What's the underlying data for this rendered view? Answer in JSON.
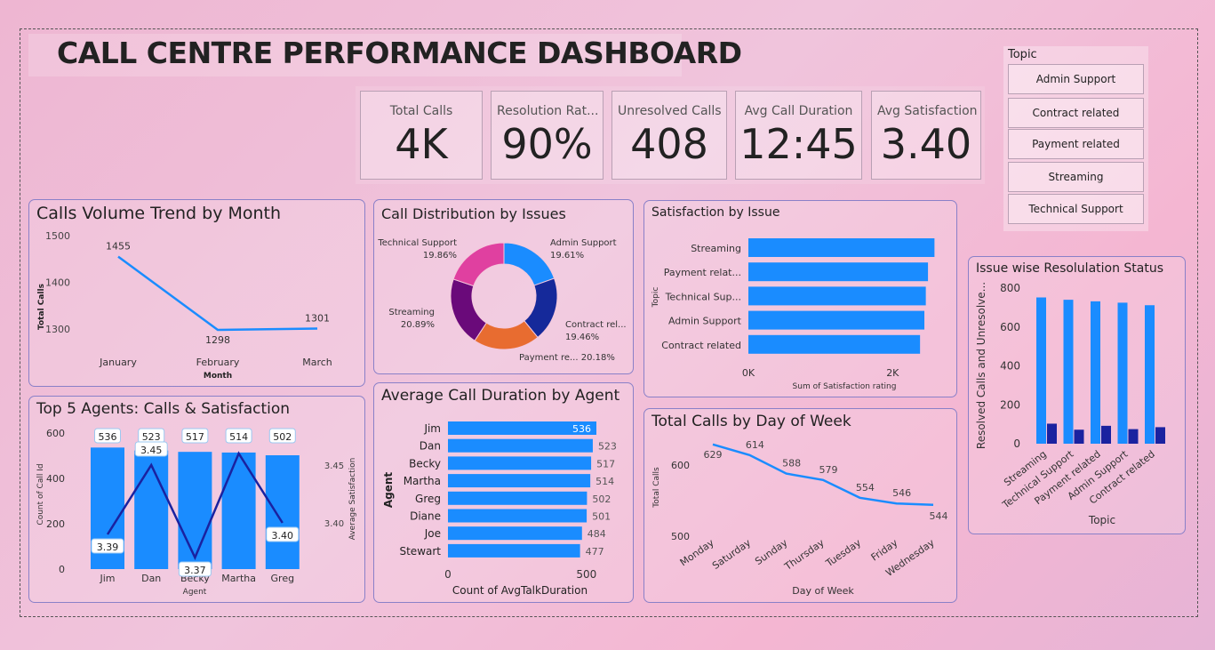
{
  "title": "CALL CENTRE PERFORMANCE DASHBOARD",
  "kpis": [
    {
      "label": "Total Calls",
      "value": "4K"
    },
    {
      "label": "Resolution Rat...",
      "value": "90%"
    },
    {
      "label": "Unresolved Calls",
      "value": "408"
    },
    {
      "label": "Avg Call Duration",
      "value": "12:45"
    },
    {
      "label": "Avg Satisfaction",
      "value": "3.40"
    }
  ],
  "slicer": {
    "header": "Topic",
    "items": [
      "Admin Support",
      "Contract related",
      "Payment related",
      "Streaming",
      "Technical Support"
    ]
  },
  "colors": {
    "bar": "#1a8cff",
    "dark": "#1a22a0",
    "pink": "#e040a0",
    "purple": "#6a0a7a",
    "orange": "#e86c30",
    "navy": "#15299a"
  },
  "chart_data": [
    {
      "id": "calls_trend",
      "type": "line",
      "title": "Calls Volume Trend by Month",
      "xlabel": "Month",
      "ylabel": "Total Calls",
      "categories": [
        "January",
        "February",
        "March"
      ],
      "values": [
        1455,
        1298,
        1301
      ],
      "data_labels": [
        "1455",
        "1298",
        "1301"
      ],
      "yticks": [
        "1500",
        "1400",
        "1300"
      ],
      "ylim": [
        1300,
        1500
      ]
    },
    {
      "id": "issue_distribution",
      "type": "pie",
      "title": "Call Distribution by Issues",
      "slices": [
        {
          "name": "Admin Support",
          "value": 19.61,
          "label": "19.61%"
        },
        {
          "name": "Contract rel...",
          "value": 19.46,
          "label": "19.46%"
        },
        {
          "name": "Payment re...",
          "value": 20.18,
          "label": "20.18%"
        },
        {
          "name": "Streaming",
          "value": 20.89,
          "label": "20.89%"
        },
        {
          "name": "Technical Support",
          "value": 19.86,
          "label": "19.86%"
        }
      ]
    },
    {
      "id": "satisfaction_by_issue",
      "type": "bar",
      "title": "Satisfaction by Issue",
      "xlabel": "Sum of Satisfaction rating",
      "ylabel": "Topic",
      "categories": [
        "Streaming",
        "Payment relat...",
        "Technical Sup...",
        "Admin Support",
        "Contract related"
      ],
      "values": [
        2580,
        2490,
        2460,
        2440,
        2380
      ],
      "xticks": [
        "0K",
        "2K"
      ],
      "xlim": [
        0,
        2600
      ]
    },
    {
      "id": "issue_resolution",
      "type": "bar",
      "title": "Issue wise Resolulation Status",
      "xlabel": "Topic",
      "ylabel": "Resolved Calls and Unresolve...",
      "categories": [
        "Streaming",
        "Technical Support",
        "Payment related",
        "Admin Support",
        "Contract related"
      ],
      "series": [
        {
          "values": [
            752,
            740,
            732,
            725,
            712
          ]
        },
        {
          "values": [
            103,
            72,
            92,
            75,
            85
          ]
        }
      ],
      "yticks": [
        "800",
        "600",
        "400",
        "200",
        "0"
      ],
      "ylim": [
        0,
        800
      ]
    },
    {
      "id": "top_agents",
      "type": "bar",
      "title": "Top 5 Agents: Calls & Satisfaction",
      "xlabel": "Agent",
      "ylabel": "Count of Call Id",
      "y2label": "Average Satisfaction",
      "categories": [
        "Jim",
        "Dan",
        "Becky",
        "Martha",
        "Greg"
      ],
      "values": [
        536,
        523,
        517,
        514,
        502
      ],
      "line_values": [
        3.39,
        3.45,
        3.37,
        3.46,
        3.4
      ],
      "line_labels": [
        "3.39",
        "3.45",
        "3.37",
        "",
        "3.40"
      ],
      "yticks": [
        "600",
        "400",
        "200",
        "0"
      ],
      "y2ticks": [
        "3.45",
        "3.40"
      ],
      "ylim": [
        0,
        600
      ]
    },
    {
      "id": "avg_duration",
      "type": "bar",
      "title": "Average Call Duration by Agent",
      "xlabel": "Count of AvgTalkDuration",
      "ylabel": "Agent",
      "categories": [
        "Jim",
        "Dan",
        "Becky",
        "Martha",
        "Greg",
        "Diane",
        "Joe",
        "Stewart"
      ],
      "values": [
        536,
        523,
        517,
        514,
        502,
        501,
        484,
        477
      ],
      "xticks": [
        "0",
        "500"
      ],
      "xlim": [
        0,
        536
      ]
    },
    {
      "id": "calls_by_day",
      "type": "line",
      "title": "Total Calls by Day of Week",
      "xlabel": "Day of Week",
      "ylabel": "Total Calls",
      "categories": [
        "Monday",
        "Saturday",
        "Sunday",
        "Thursday",
        "Tuesday",
        "Friday",
        "Wednesday"
      ],
      "values": [
        629,
        614,
        588,
        579,
        554,
        546,
        544
      ],
      "yticks": [
        "600",
        "500"
      ],
      "ylim": [
        500,
        640
      ]
    }
  ]
}
